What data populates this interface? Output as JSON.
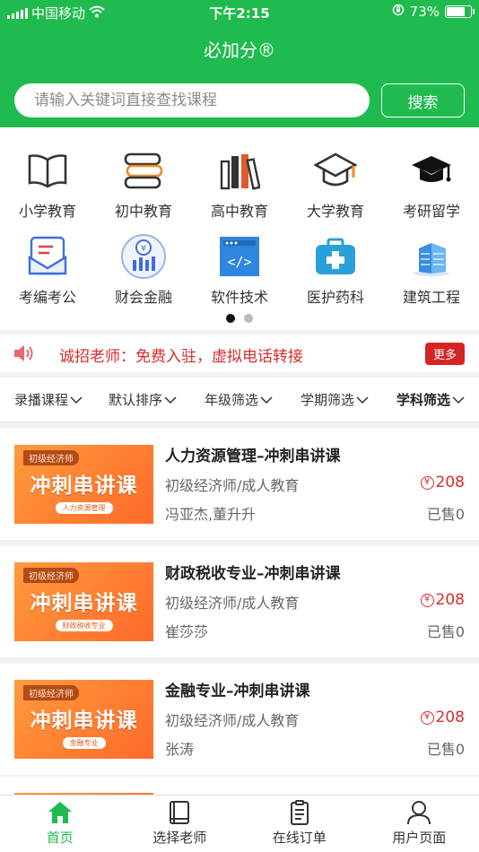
{
  "status": {
    "carrier": "中国移动",
    "time": "下午2:15",
    "battery": "73%"
  },
  "app": {
    "title": "必加分®"
  },
  "search": {
    "placeholder": "请输入关键词直接查找课程",
    "button": "搜索"
  },
  "categories": [
    {
      "label": "小学教育",
      "icon": "open-book-icon"
    },
    {
      "label": "初中教育",
      "icon": "stacked-books-icon"
    },
    {
      "label": "高中教育",
      "icon": "bookshelf-icon"
    },
    {
      "label": "大学教育",
      "icon": "grad-cap-outline-icon"
    },
    {
      "label": "考研留学",
      "icon": "grad-cap-icon"
    },
    {
      "label": "考编考公",
      "icon": "document-envelope-icon"
    },
    {
      "label": "财会金融",
      "icon": "yen-chart-icon"
    },
    {
      "label": "软件技术",
      "icon": "code-window-icon"
    },
    {
      "label": "医护药科",
      "icon": "medical-kit-icon"
    },
    {
      "label": "建筑工程",
      "icon": "building-icon"
    }
  ],
  "pager": {
    "pages": 2,
    "active": 0
  },
  "notice": {
    "text": "诚招老师：免费入驻，虚拟电话转接",
    "more": "更多"
  },
  "filters": [
    {
      "label": "录播课程"
    },
    {
      "label": "默认排序"
    },
    {
      "label": "年级筛选"
    },
    {
      "label": "学期筛选"
    },
    {
      "label": "学科筛选"
    }
  ],
  "courses": [
    {
      "title": "人力资源管理–冲刺串讲课",
      "category": "初级经济师/成人教育",
      "teacher": "冯亚杰,董升升",
      "price": "208",
      "sold": "已售0",
      "thumb": {
        "tag": "初级经济师",
        "headline": "冲刺串讲课",
        "subject": "人力资源管理"
      }
    },
    {
      "title": "财政税收专业–冲刺串讲课",
      "category": "初级经济师/成人教育",
      "teacher": "崔莎莎",
      "price": "208",
      "sold": "已售0",
      "thumb": {
        "tag": "初级经济师",
        "headline": "冲刺串讲课",
        "subject": "财政税收专业"
      }
    },
    {
      "title": "金融专业–冲刺串讲课",
      "category": "初级经济师/成人教育",
      "teacher": "张涛",
      "price": "208",
      "sold": "已售0",
      "thumb": {
        "tag": "初级经济师",
        "headline": "冲刺串讲课",
        "subject": "金融专业"
      }
    }
  ],
  "tabs": [
    {
      "label": "首页",
      "icon": "home-icon",
      "active": true
    },
    {
      "label": "选择老师",
      "icon": "book-icon",
      "active": false
    },
    {
      "label": "在线订单",
      "icon": "clipboard-icon",
      "active": false
    },
    {
      "label": "用户页面",
      "icon": "user-icon",
      "active": false
    }
  ],
  "colors": {
    "brand": "#1fbb4e",
    "price": "#d92b2b",
    "thumb": "#ff7a2e"
  }
}
